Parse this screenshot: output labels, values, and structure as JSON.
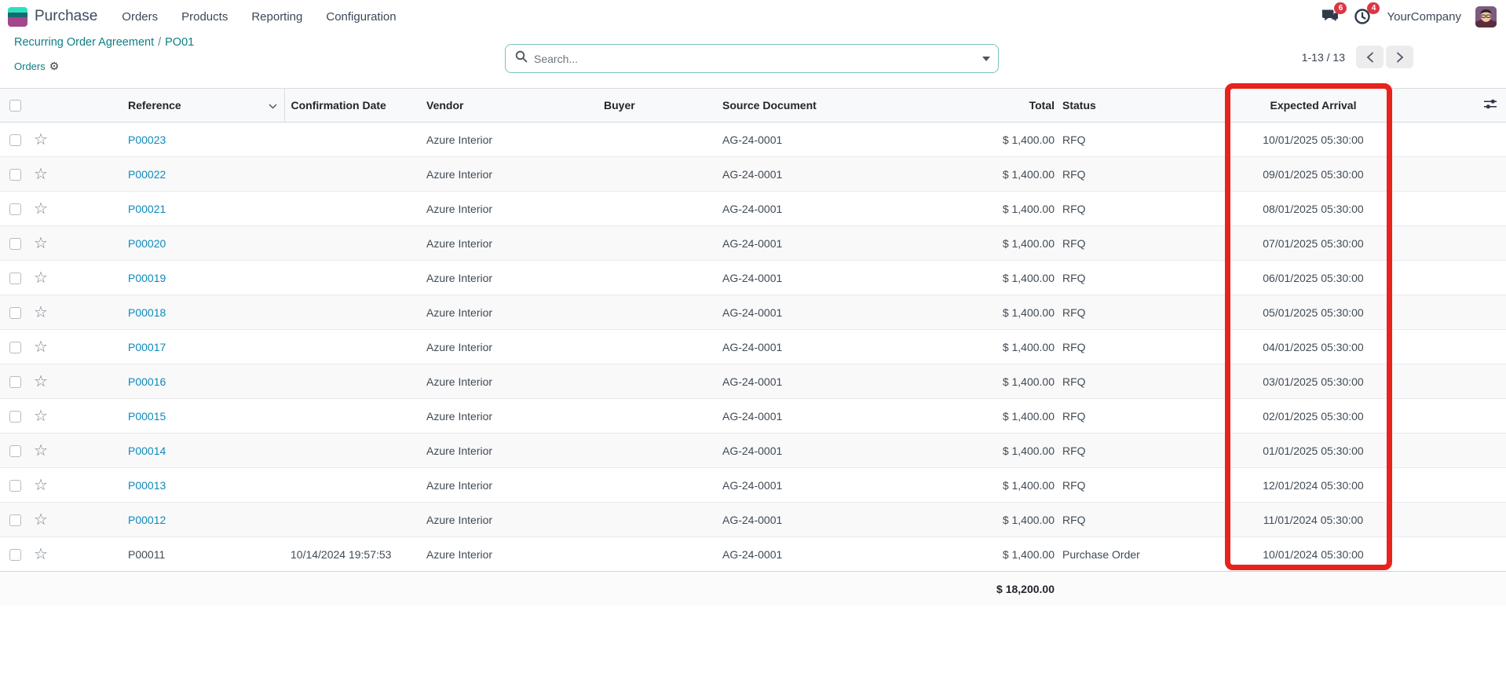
{
  "app": {
    "name": "Purchase"
  },
  "nav": {
    "menus": [
      "Orders",
      "Products",
      "Reporting",
      "Configuration"
    ],
    "messages_badge": "6",
    "activities_badge": "4",
    "company": "YourCompany"
  },
  "breadcrumb": {
    "parent": "Recurring Order Agreement",
    "separator": "/",
    "current": "PO01",
    "action": "Orders"
  },
  "search": {
    "placeholder": "Search..."
  },
  "pager": {
    "range": "1-13 / 13"
  },
  "table": {
    "headers": {
      "reference": "Reference",
      "confirmation_date": "Confirmation Date",
      "vendor": "Vendor",
      "buyer": "Buyer",
      "source_document": "Source Document",
      "total": "Total",
      "status": "Status",
      "expected_arrival": "Expected Arrival"
    },
    "rows": [
      {
        "reference": "P00023",
        "confirmation_date": "",
        "vendor": "Azure Interior",
        "buyer": "",
        "source_document": "AG-24-0001",
        "total": "$ 1,400.00",
        "status": "RFQ",
        "expected_arrival": "10/01/2025 05:30:00",
        "is_link": true
      },
      {
        "reference": "P00022",
        "confirmation_date": "",
        "vendor": "Azure Interior",
        "buyer": "",
        "source_document": "AG-24-0001",
        "total": "$ 1,400.00",
        "status": "RFQ",
        "expected_arrival": "09/01/2025 05:30:00",
        "is_link": true
      },
      {
        "reference": "P00021",
        "confirmation_date": "",
        "vendor": "Azure Interior",
        "buyer": "",
        "source_document": "AG-24-0001",
        "total": "$ 1,400.00",
        "status": "RFQ",
        "expected_arrival": "08/01/2025 05:30:00",
        "is_link": true
      },
      {
        "reference": "P00020",
        "confirmation_date": "",
        "vendor": "Azure Interior",
        "buyer": "",
        "source_document": "AG-24-0001",
        "total": "$ 1,400.00",
        "status": "RFQ",
        "expected_arrival": "07/01/2025 05:30:00",
        "is_link": true
      },
      {
        "reference": "P00019",
        "confirmation_date": "",
        "vendor": "Azure Interior",
        "buyer": "",
        "source_document": "AG-24-0001",
        "total": "$ 1,400.00",
        "status": "RFQ",
        "expected_arrival": "06/01/2025 05:30:00",
        "is_link": true
      },
      {
        "reference": "P00018",
        "confirmation_date": "",
        "vendor": "Azure Interior",
        "buyer": "",
        "source_document": "AG-24-0001",
        "total": "$ 1,400.00",
        "status": "RFQ",
        "expected_arrival": "05/01/2025 05:30:00",
        "is_link": true
      },
      {
        "reference": "P00017",
        "confirmation_date": "",
        "vendor": "Azure Interior",
        "buyer": "",
        "source_document": "AG-24-0001",
        "total": "$ 1,400.00",
        "status": "RFQ",
        "expected_arrival": "04/01/2025 05:30:00",
        "is_link": true
      },
      {
        "reference": "P00016",
        "confirmation_date": "",
        "vendor": "Azure Interior",
        "buyer": "",
        "source_document": "AG-24-0001",
        "total": "$ 1,400.00",
        "status": "RFQ",
        "expected_arrival": "03/01/2025 05:30:00",
        "is_link": true
      },
      {
        "reference": "P00015",
        "confirmation_date": "",
        "vendor": "Azure Interior",
        "buyer": "",
        "source_document": "AG-24-0001",
        "total": "$ 1,400.00",
        "status": "RFQ",
        "expected_arrival": "02/01/2025 05:30:00",
        "is_link": true
      },
      {
        "reference": "P00014",
        "confirmation_date": "",
        "vendor": "Azure Interior",
        "buyer": "",
        "source_document": "AG-24-0001",
        "total": "$ 1,400.00",
        "status": "RFQ",
        "expected_arrival": "01/01/2025 05:30:00",
        "is_link": true
      },
      {
        "reference": "P00013",
        "confirmation_date": "",
        "vendor": "Azure Interior",
        "buyer": "",
        "source_document": "AG-24-0001",
        "total": "$ 1,400.00",
        "status": "RFQ",
        "expected_arrival": "12/01/2024 05:30:00",
        "is_link": true
      },
      {
        "reference": "P00012",
        "confirmation_date": "",
        "vendor": "Azure Interior",
        "buyer": "",
        "source_document": "AG-24-0001",
        "total": "$ 1,400.00",
        "status": "RFQ",
        "expected_arrival": "11/01/2024 05:30:00",
        "is_link": true
      },
      {
        "reference": "P00011",
        "confirmation_date": "10/14/2024 19:57:53",
        "vendor": "Azure Interior",
        "buyer": "",
        "source_document": "AG-24-0001",
        "total": "$ 1,400.00",
        "status": "Purchase Order",
        "expected_arrival": "10/01/2024 05:30:00",
        "is_link": false
      }
    ],
    "footer_total": "$ 18,200.00"
  },
  "colors": {
    "accent_teal": "#0f7e83",
    "link_blue": "#0d8abc",
    "badge_red": "#dc3545",
    "highlight_red": "#e8231d"
  }
}
